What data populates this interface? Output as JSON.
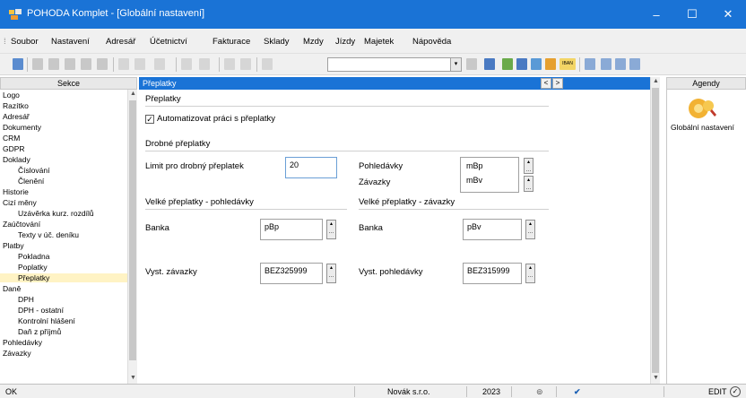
{
  "window": {
    "title": "POHODA Komplet - [Globální nastavení]",
    "minimize": "–",
    "maximize": "☐",
    "close": "✕"
  },
  "menu": {
    "items": [
      {
        "label": "Soubor"
      },
      {
        "label": "Nastavení"
      },
      {
        "label": "Adresář"
      },
      {
        "label": "Účetnictví"
      },
      {
        "label": "Fakturace"
      },
      {
        "label": "Sklady"
      },
      {
        "label": "Mzdy"
      },
      {
        "label": "Jízdy"
      },
      {
        "label": "Majetek"
      },
      {
        "label": "Nápověda"
      }
    ]
  },
  "toolbar": {
    "iban": "IBAN"
  },
  "sekce": {
    "header": "Sekce",
    "items": [
      {
        "label": "Logo",
        "indent": 0
      },
      {
        "label": "Razítko",
        "indent": 0
      },
      {
        "label": "Adresář",
        "indent": 0
      },
      {
        "label": "Dokumenty",
        "indent": 0
      },
      {
        "label": "CRM",
        "indent": 0
      },
      {
        "label": "GDPR",
        "indent": 0
      },
      {
        "label": "Doklady",
        "indent": 0
      },
      {
        "label": "Číslování",
        "indent": 1
      },
      {
        "label": "Členění",
        "indent": 1
      },
      {
        "label": "Historie",
        "indent": 0
      },
      {
        "label": "Cizí měny",
        "indent": 0
      },
      {
        "label": "Uzávěrka kurz. rozdílů",
        "indent": 1
      },
      {
        "label": "Zaúčtování",
        "indent": 0
      },
      {
        "label": "Texty v úč. deníku",
        "indent": 1
      },
      {
        "label": "Platby",
        "indent": 0
      },
      {
        "label": "Pokladna",
        "indent": 1
      },
      {
        "label": "Poplatky",
        "indent": 1
      },
      {
        "label": "Přeplatky",
        "indent": 1,
        "selected": true
      },
      {
        "label": "Daně",
        "indent": 0
      },
      {
        "label": "DPH",
        "indent": 1
      },
      {
        "label": "DPH - ostatní",
        "indent": 1
      },
      {
        "label": "Kontrolní hlášení",
        "indent": 1
      },
      {
        "label": "Daň z příjmů",
        "indent": 1
      },
      {
        "label": "Pohledávky",
        "indent": 0
      },
      {
        "label": "Závazky",
        "indent": 0
      }
    ]
  },
  "main": {
    "header": "Přeplatky",
    "nav_prev": "<",
    "nav_next": ">",
    "group1_title": "Přeplatky",
    "auto_checkbox_label": "Automatizovat práci s přeplatky",
    "auto_checked": true,
    "group2_title": "Drobné přeplatky",
    "limit_label": "Limit pro drobný přeplatek",
    "limit_value": "20",
    "pohledavky_label": "Pohledávky",
    "pohledavky_value": "mBp",
    "zavazky_label": "Závazky",
    "zavazky_value": "mBv",
    "group3_title": "Velké přeplatky - pohledávky",
    "group4_title": "Velké přeplatky - závazky",
    "banka1_label": "Banka",
    "banka1_value": "pBp",
    "banka2_label": "Banka",
    "banka2_value": "pBv",
    "vyst_zav_label": "Vyst. závazky",
    "vyst_zav_value": "BEZ325999",
    "vyst_poh_label": "Vyst. pohledávky",
    "vyst_poh_value": "BEZ315999"
  },
  "agendy": {
    "header": "Agendy",
    "item": "Globální nastavení"
  },
  "status": {
    "ok": "OK",
    "company": "Novák s.r.o.",
    "year": "2023",
    "mode": "EDIT"
  }
}
